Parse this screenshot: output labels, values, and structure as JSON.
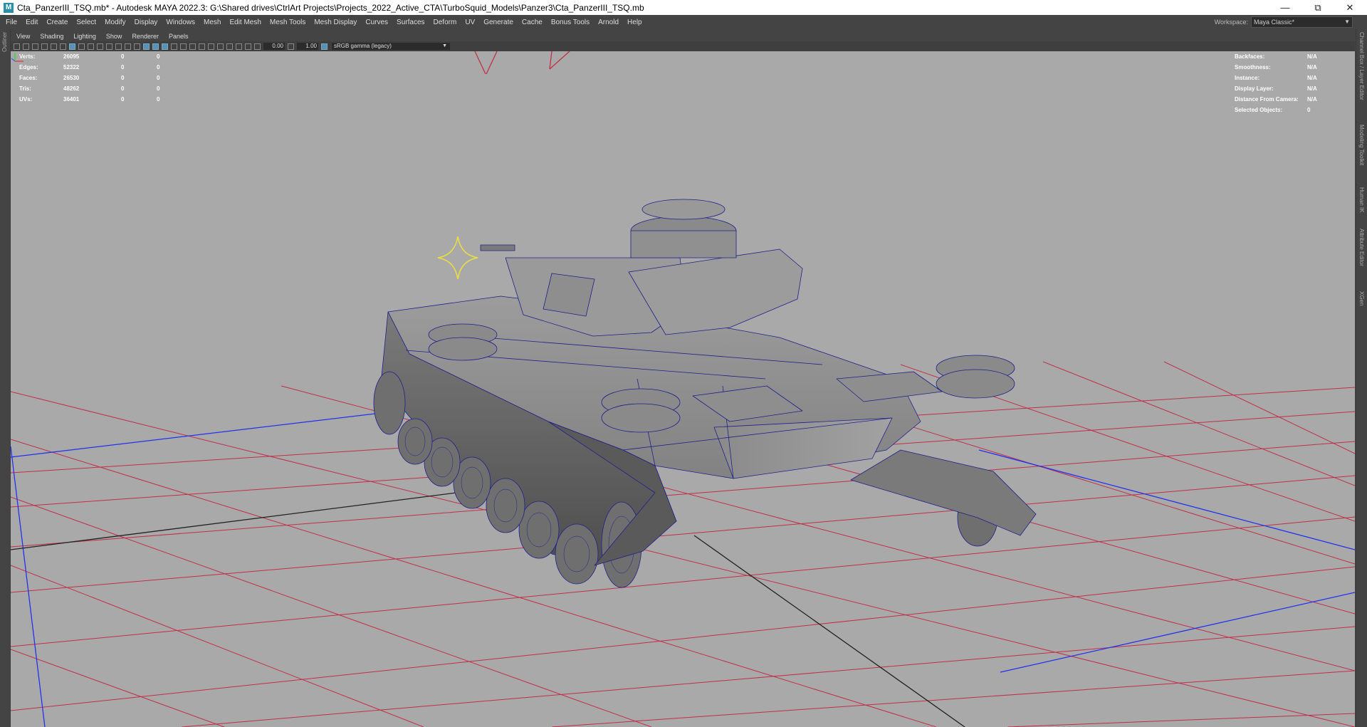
{
  "window": {
    "app_icon": "M",
    "title": "Cta_PanzerIII_TSQ.mb* - Autodesk MAYA 2022.3: G:\\Shared drives\\CtrlArt Projects\\Projects_2022_Active_CTA\\TurboSquid_Models\\Panzer3\\Cta_PanzerIII_TSQ.mb",
    "controls": [
      "minimize-icon",
      "restore-icon",
      "close-icon"
    ]
  },
  "menubar": {
    "items": [
      "File",
      "Edit",
      "Create",
      "Select",
      "Modify",
      "Display",
      "Windows",
      "Mesh",
      "Edit Mesh",
      "Mesh Tools",
      "Mesh Display",
      "Curves",
      "Surfaces",
      "Deform",
      "UV",
      "Generate",
      "Cache",
      "Bonus Tools",
      "Arnold",
      "Help"
    ],
    "workspace_label": "Workspace:",
    "workspace_value": "Maya Classic*"
  },
  "left_strip": {
    "tab": "Outliner"
  },
  "right_strip": {
    "tabs": [
      "Channel Box / Layer Editor",
      "Modeling Toolkit",
      "Human IK",
      "Attribute Editor",
      "XGen"
    ]
  },
  "panel_menu": {
    "items": [
      "View",
      "Shading",
      "Lighting",
      "Show",
      "Renderer",
      "Panels"
    ]
  },
  "toolbar": {
    "exposure": "0.00",
    "gamma": "1.00",
    "color_space": "sRGB gamma (legacy)"
  },
  "hud_left": {
    "rows": [
      {
        "label": "Verts:",
        "v1": "26095",
        "v2": "0",
        "v3": "0"
      },
      {
        "label": "Edges:",
        "v1": "52322",
        "v2": "0",
        "v3": "0"
      },
      {
        "label": "Faces:",
        "v1": "26530",
        "v2": "0",
        "v3": "0"
      },
      {
        "label": "Tris:",
        "v1": "48262",
        "v2": "0",
        "v3": "0"
      },
      {
        "label": "UVs:",
        "v1": "36401",
        "v2": "0",
        "v3": "0"
      }
    ]
  },
  "hud_right": {
    "rows": [
      {
        "label": "Backfaces:",
        "value": "N/A"
      },
      {
        "label": "Smoothness:",
        "value": "N/A"
      },
      {
        "label": "Instance:",
        "value": "N/A"
      },
      {
        "label": "Display Layer:",
        "value": "N/A"
      },
      {
        "label": "Distance From Camera:",
        "value": "N/A"
      },
      {
        "label": "Selected Objects:",
        "value": "0"
      }
    ]
  },
  "colors": {
    "viewport_bg": "#a9a9a9",
    "grid_red": "#c0304a",
    "grid_axis_blue": "#2233ee",
    "grid_axis_dark": "#222222",
    "wire_blue": "#20208a",
    "light_yellow": "#e8e040"
  }
}
